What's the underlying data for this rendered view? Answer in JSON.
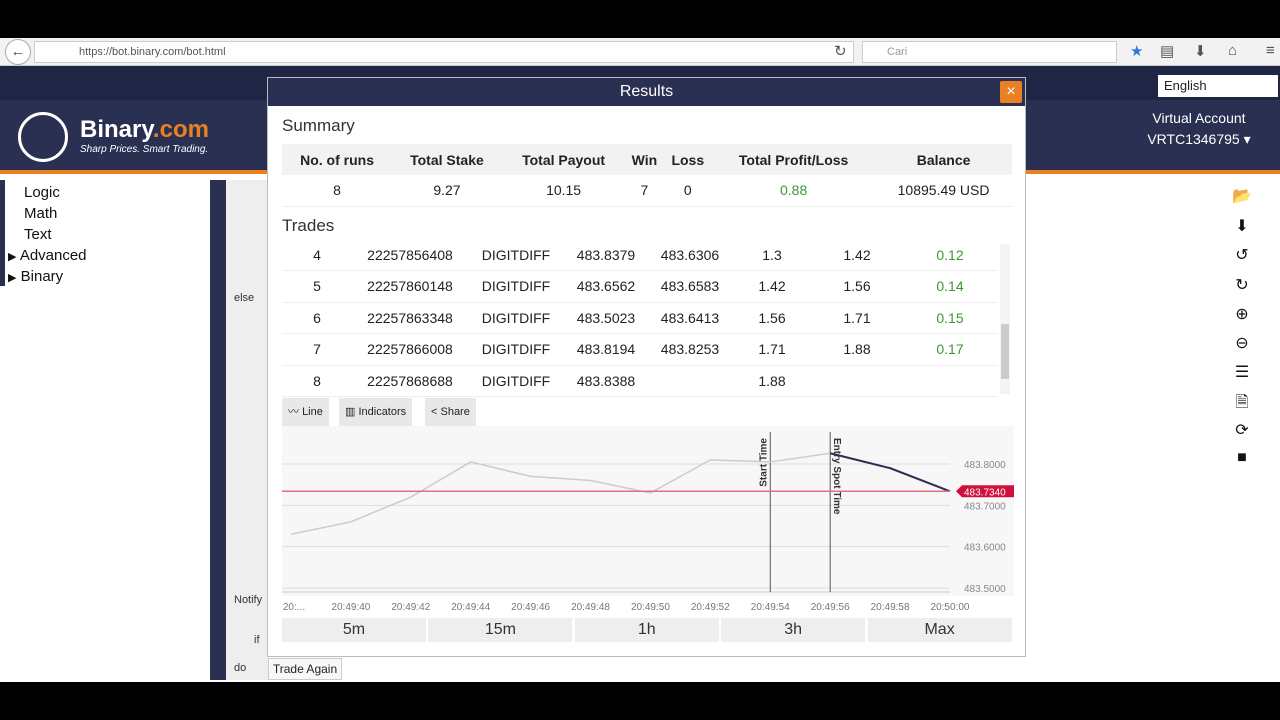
{
  "browser": {
    "url": "https://bot.binary.com/bot.html",
    "search_placeholder": "Cari"
  },
  "header": {
    "brand": "Binary",
    "brand_suffix": ".com",
    "tagline": "Sharp Prices. Smart Trading.",
    "language": "English",
    "account_type": "Virtual Account",
    "account_id": "VRTC1346795"
  },
  "sidebar": {
    "items": [
      {
        "label": "Logic"
      },
      {
        "label": "Math"
      },
      {
        "label": "Text"
      },
      {
        "label": "Advanced",
        "arrow": "▶"
      },
      {
        "label": "Binary",
        "arrow": "▶"
      }
    ]
  },
  "workspace": {
    "else": "else",
    "notify": "Notify",
    "if": "if",
    "do": "do"
  },
  "modal": {
    "title": "Results",
    "close": "×",
    "summary_title": "Summary",
    "summary_headers": [
      "No. of runs",
      "Total Stake",
      "Total Payout",
      "Win",
      "Loss",
      "Total Profit/Loss",
      "Balance"
    ],
    "summary_values": [
      "8",
      "9.27",
      "10.15",
      "7",
      "0",
      "0.88",
      "10895.49 USD"
    ],
    "trades_title": "Trades",
    "trades": [
      [
        "4",
        "22257856408",
        "DIGITDIFF",
        "483.8379",
        "483.6306",
        "1.3",
        "1.42",
        "0.12"
      ],
      [
        "5",
        "22257860148",
        "DIGITDIFF",
        "483.6562",
        "483.6583",
        "1.42",
        "1.56",
        "0.14"
      ],
      [
        "6",
        "22257863348",
        "DIGITDIFF",
        "483.5023",
        "483.6413",
        "1.56",
        "1.71",
        "0.15"
      ],
      [
        "7",
        "22257866008",
        "DIGITDIFF",
        "483.8194",
        "483.8253",
        "1.71",
        "1.88",
        "0.17"
      ],
      [
        "8",
        "22257868688",
        "DIGITDIFF",
        "483.8388",
        "",
        "1.88",
        "",
        ""
      ]
    ],
    "chart_buttons": [
      "Line",
      "Indicators",
      "Share"
    ],
    "ranges": [
      "5m",
      "15m",
      "1h",
      "3h",
      "Max"
    ],
    "trade_again": "Trade Again"
  },
  "chart_data": {
    "type": "line",
    "x_labels": [
      "20:...",
      "20:49:40",
      "20:49:42",
      "20:49:44",
      "20:49:46",
      "20:49:48",
      "20:49:50",
      "20:49:52",
      "20:49:54",
      "20:49:56",
      "20:49:58",
      "20:50:00"
    ],
    "y_ticks": [
      "483.8000",
      "483.7000",
      "483.6000",
      "483.5000"
    ],
    "ylim": [
      483.5,
      483.84
    ],
    "xlim": [
      37.7,
      60
    ],
    "series": [
      {
        "name": "tick",
        "x": [
          38,
          40,
          42,
          44,
          46,
          48,
          50,
          52,
          54,
          56,
          58,
          60
        ],
        "y": [
          483.63,
          483.66,
          483.72,
          483.805,
          483.77,
          483.76,
          483.73,
          483.81,
          483.805,
          483.826,
          483.79,
          483.734
        ]
      }
    ],
    "highlight_from_x": 56,
    "current_price": "483.7340",
    "current_value": 483.734,
    "markers": [
      {
        "label": "Start Time",
        "x": 54
      },
      {
        "label": "Entry Spot Time",
        "x": 56
      }
    ]
  },
  "colors": {
    "navy": "#2a3052",
    "orange": "#e98024",
    "green": "#3a9a2e",
    "price": "#d0103a"
  }
}
